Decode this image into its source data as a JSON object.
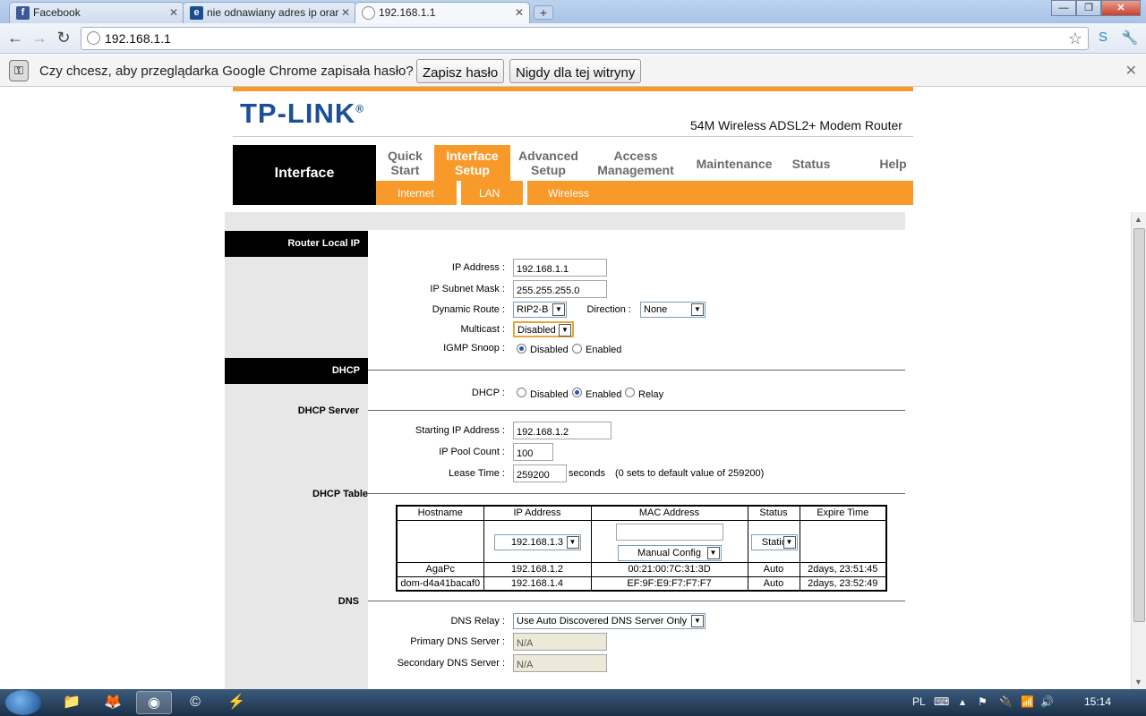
{
  "tabs": [
    {
      "title": "Facebook",
      "favicon": "f",
      "color": "#3b5998"
    },
    {
      "title": "nie odnawiany adres ip orar",
      "favicon": "e",
      "color": "#1a4f8f"
    },
    {
      "title": "192.168.1.1",
      "favicon": "",
      "color": "#999999"
    }
  ],
  "address": "192.168.1.1",
  "infobar": {
    "message": "Czy chcesz, aby przeglądarka Google Chrome zapisała hasło?",
    "save_label": "Zapisz hasło",
    "never_label": "Nigdy dla tej witryny"
  },
  "header": {
    "logo": "TP-LINK",
    "logo_mark": "®",
    "product": "54M Wireless ADSL2+ Modem Router",
    "section": "Interface"
  },
  "menu": [
    {
      "line1": "Quick",
      "line2": "Start"
    },
    {
      "line1": "Interface",
      "line2": "Setup"
    },
    {
      "line1": "Advanced",
      "line2": "Setup"
    },
    {
      "line1": "Access",
      "line2": "Management"
    },
    {
      "line1": "Maintenance",
      "line2": ""
    },
    {
      "line1": "Status",
      "line2": ""
    },
    {
      "line1": "Help",
      "line2": ""
    }
  ],
  "submenu": [
    "Internet",
    "LAN",
    "Wireless"
  ],
  "router_ip": {
    "title": "Router Local IP",
    "ip_label": "IP Address :",
    "ip_value": "192.168.1.1",
    "mask_label": "IP Subnet Mask :",
    "mask_value": "255.255.255.0",
    "route_label": "Dynamic Route :",
    "route_value": "RIP2-B",
    "direction_label": "Direction :",
    "direction_value": "None",
    "multicast_label": "Multicast :",
    "multicast_value": "Disabled",
    "igmp_label": "IGMP Snoop :",
    "igmp_disabled": "Disabled",
    "igmp_enabled": "Enabled"
  },
  "dhcp": {
    "title": "DHCP",
    "dhcp_label": "DHCP :",
    "opt_disabled": "Disabled",
    "opt_enabled": "Enabled",
    "opt_relay": "Relay",
    "server_title": "DHCP Server",
    "start_label": "Starting IP Address :",
    "start_value": "192.168.1.2",
    "pool_label": "IP Pool Count :",
    "pool_value": "100",
    "lease_label": "Lease Time :",
    "lease_value": "259200",
    "lease_unit": "seconds",
    "lease_note": "(0 sets to default value of 259200)"
  },
  "dhcp_table": {
    "title": "DHCP Table",
    "headers": [
      "Hostname",
      "IP Address",
      "MAC Address",
      "Status",
      "Expire Time"
    ],
    "ip_select": "192.168.1.3",
    "mac_select": "Manual Config",
    "status_select": "Static",
    "rows": [
      [
        "AgaPc",
        "192.168.1.2",
        "00:21:00:7C:31:3D",
        "Auto",
        "2days, 23:51:45"
      ],
      [
        "dom-d4a41bacaf0",
        "192.168.1.4",
        "EF:9F:E9:F7:F7:F7",
        "Auto",
        "2days, 23:52:49"
      ]
    ]
  },
  "dns": {
    "title": "DNS",
    "relay_label": "DNS Relay :",
    "relay_value": "Use Auto Discovered DNS Server Only",
    "primary_label": "Primary DNS Server :",
    "primary_value": "N/A",
    "secondary_label": "Secondary DNS Server :",
    "secondary_value": "N/A"
  },
  "taskbar": {
    "lang": "PL",
    "time": "15:14"
  }
}
